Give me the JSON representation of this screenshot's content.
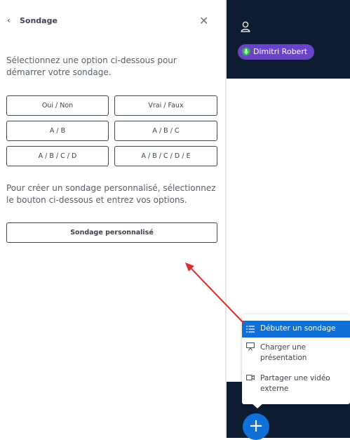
{
  "poll_panel": {
    "back_icon": "chevron-left-icon",
    "title": "Sondage",
    "close_icon": "close-icon",
    "instruction": "Sélectionnez une option ci-dessous pour démarrer votre sondage.",
    "options": [
      "Oui / Non",
      "Vrai / Faux",
      "A / B",
      "A / B / C",
      "A / B / C / D",
      "A / B / C / D / E"
    ],
    "custom_instruction": "Pour créer un sondage personnalisé, sélectionnez le bouton ci-dessous et entrez vos options.",
    "custom_button": "Sondage personnalisé"
  },
  "user_list": {
    "user_icon": "user-icon",
    "presenter_name": "Dimitri Robert",
    "presenter_color": "#6a44c8"
  },
  "actions_menu": {
    "items": [
      {
        "icon": "list-icon",
        "label": "Débuter un sondage",
        "active": true
      },
      {
        "icon": "presentation-icon",
        "label": "Charger une présentation",
        "active": false
      },
      {
        "icon": "video-icon",
        "label": "Partager une vidéo externe",
        "active": false
      }
    ],
    "fab_icon": "plus-icon",
    "fab_label": "+",
    "accent_color": "#0f70d7"
  },
  "annotation": {
    "arrow_color": "#d9302c"
  }
}
